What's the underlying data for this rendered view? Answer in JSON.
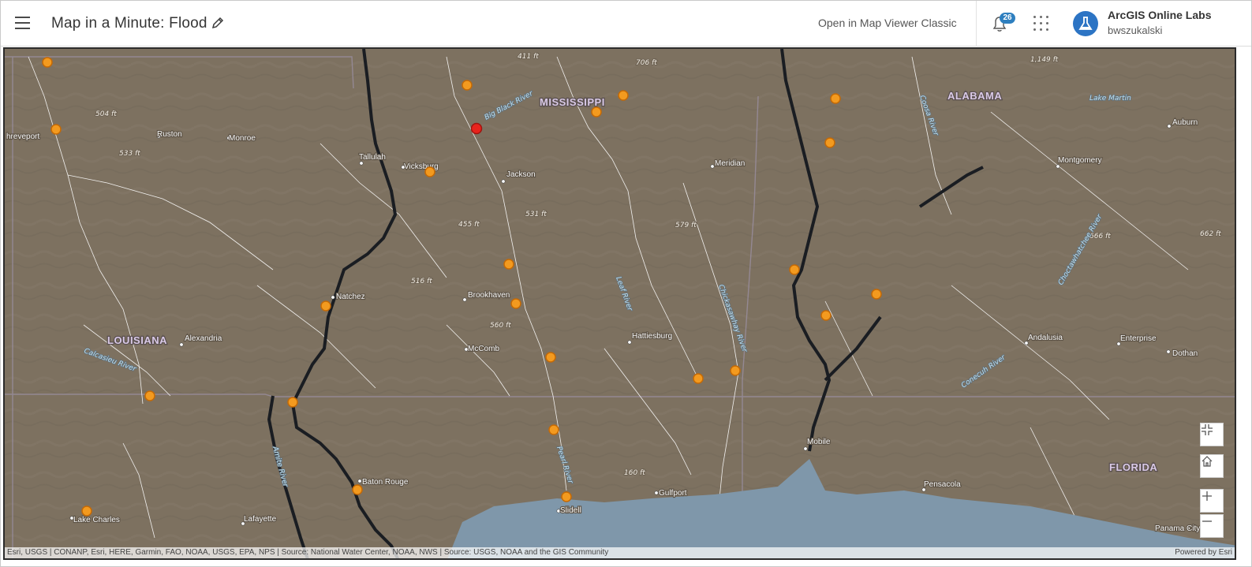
{
  "header": {
    "title": "Map in a Minute: Flood",
    "open_classic": "Open in Map Viewer Classic",
    "notifications_count": "26",
    "org_name": "ArcGIS Online Labs",
    "username": "bwszukalski"
  },
  "map": {
    "state_labels": [
      "MISSISSIPPI",
      "ALABAMA",
      "LOUISIANA",
      "FLORIDA"
    ],
    "cities": [
      "hreveport",
      "Ruston",
      "Monroe",
      "Tallulah",
      "Vicksburg",
      "Jackson",
      "Meridian",
      "Montgomery",
      "Auburn",
      "Natchez",
      "Brookhaven",
      "Hattiesburg",
      "McComb",
      "Alexandria",
      "Andalusia",
      "Enterprise",
      "Dothan",
      "Mobile",
      "Pensacola",
      "Baton Rouge",
      "Gulfport",
      "Slidell",
      "Lake Charles",
      "Lafayette",
      "Panama City"
    ],
    "elevations": [
      "411 ft",
      "706 ft",
      "1,149 ft",
      "504 ft",
      "533 ft",
      "531 ft",
      "455 ft",
      "579 ft",
      "516 ft",
      "560 ft",
      "666 ft",
      "662 ft",
      "160 ft"
    ],
    "water_labels": [
      "Big Black River",
      "Leaf River",
      "Chickasawhay River",
      "Pearl River",
      "Conecuh River",
      "Choctawhatchee River",
      "Calcasieu River",
      "Amite River",
      "Coosa River",
      "Lake Martin"
    ],
    "colors": {
      "land": "#7d7160",
      "water": "#7f97aa",
      "rivers": "#ffffff",
      "main_river": "#1a1d22",
      "gauge_orange": "#f39a1f",
      "gauge_red": "#e8231c"
    },
    "icons": [
      "menu-icon",
      "pencil-icon",
      "bell-icon",
      "app-grid-icon",
      "flask-icon",
      "collapse-icon",
      "home-icon",
      "plus-icon",
      "minus-icon"
    ]
  },
  "attribution": {
    "text": "Esri, USGS | CONANP, Esri, HERE, Garmin, FAO, NOAA, USGS, EPA, NPS | Source: National Water Center, NOAA, NWS | Source: USGS, NOAA and the GIS Community",
    "powered": "Powered by Esri"
  }
}
